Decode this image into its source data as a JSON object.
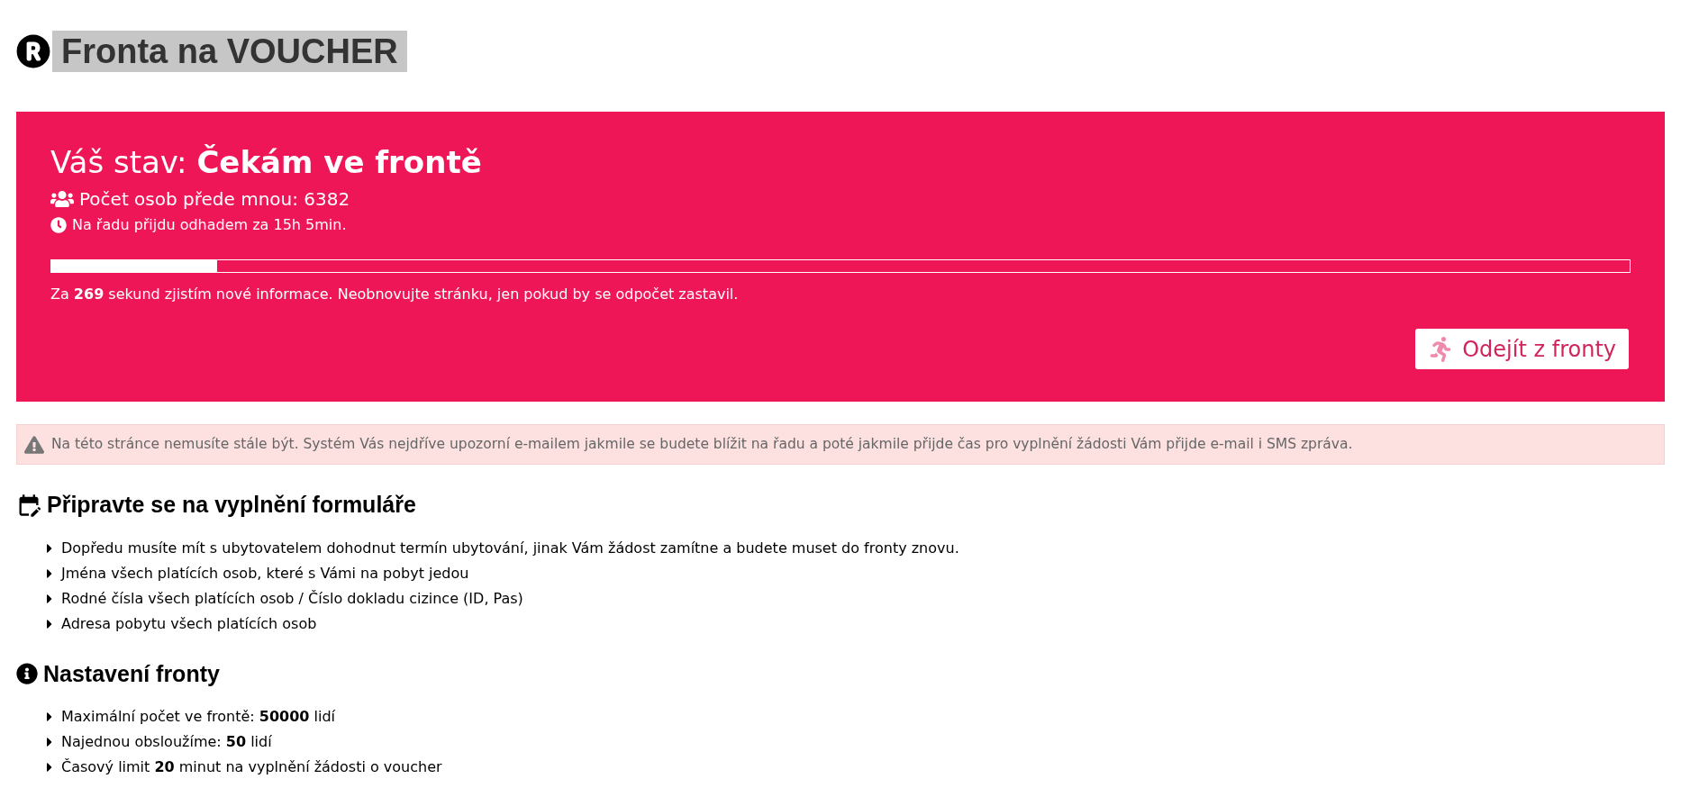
{
  "page": {
    "title": "Fronta na VOUCHER"
  },
  "status": {
    "heading": "Váš stav: **Čekám ve frontě**",
    "people_ahead": "Počet osob přede mnou: 6382",
    "estimate": "Na řadu přijdu odhadem za 15h 5min.",
    "progress": {
      "level": 0.105
    },
    "countdown": "Za **269** sekund zjistím nové informace. Neobnovujte stránku, jen pokud by se odpočet zastavil.",
    "leave_button": "Odejít z fronty"
  },
  "notice": "Na této stránce nemusíte stále být. Systém Vás nejdříve upozorní e-mailem jakmile se budete blížit na řadu a poté jakmile přijde čas pro vyplnění žádosti Vám přijde e-mail i SMS zpráva.",
  "sections": [
    {
      "kind": "form",
      "title": "Připravte se na vyplnění formuláře",
      "items": [
        "Dopředu musíte mít s ubytovatelem dohodnut termín ubytování, jinak Vám žádost zamítne a budete muset do fronty znovu.",
        "Jména všech platících osob, které s Vámi na pobyt jedou",
        "Rodné čísla všech platících osob / Číslo dokladu cizince (ID, Pas)",
        "Adresa pobytu všech platících osob"
      ]
    },
    {
      "kind": "info",
      "title": "Nastavení fronty",
      "items": [
        "Maximální počet ve frontě: **50000** lidí",
        "Najednou obsloužíme: **50** lidí",
        "Časový limit **20** minut na vyplnění žádosti o voucher"
      ]
    }
  ]
}
